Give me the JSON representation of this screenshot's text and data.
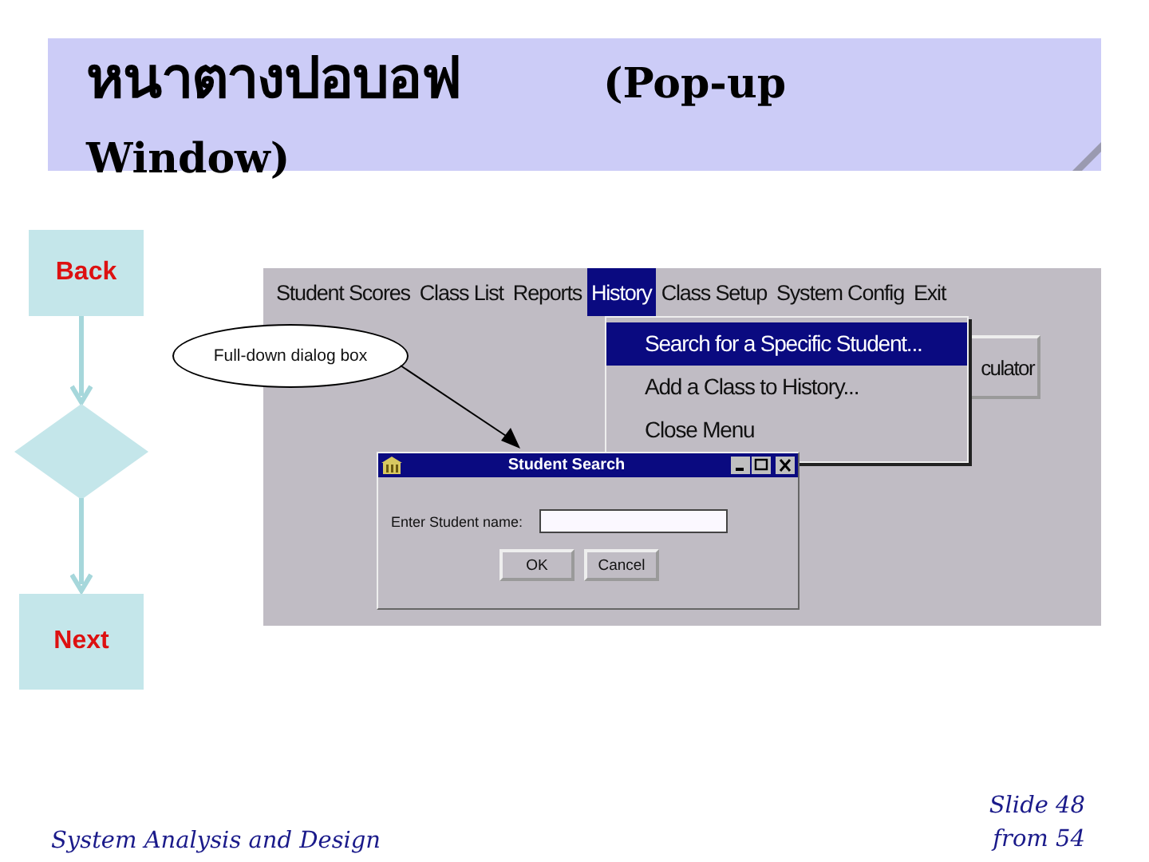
{
  "title": {
    "thai": "หนาตางปอบอฟ",
    "english": "(Pop-up Window)"
  },
  "flowchart": {
    "back": "Back",
    "next": "Next"
  },
  "app": {
    "menu": [
      {
        "label": "Student Scores",
        "selected": false
      },
      {
        "label": "Class List",
        "selected": false
      },
      {
        "label": "Reports",
        "selected": false
      },
      {
        "label": "History",
        "selected": true
      },
      {
        "label": "Class Setup",
        "selected": false
      },
      {
        "label": "System Config",
        "selected": false
      },
      {
        "label": "Exit",
        "selected": false
      }
    ],
    "dropdown": [
      {
        "label": "Search for a Specific Student...",
        "selected": true
      },
      {
        "label": "Add a Class to History...",
        "selected": false
      },
      {
        "label": "Close Menu",
        "selected": false
      }
    ],
    "button_fragment": "culator",
    "dialog": {
      "title": "Student Search",
      "field_label": "Enter Student name:",
      "buttons": [
        "OK",
        "Cancel"
      ]
    }
  },
  "callout": "Full-down dialog box",
  "footer": {
    "course": "System Analysis and Design",
    "slide": "Slide 48 from 54"
  }
}
